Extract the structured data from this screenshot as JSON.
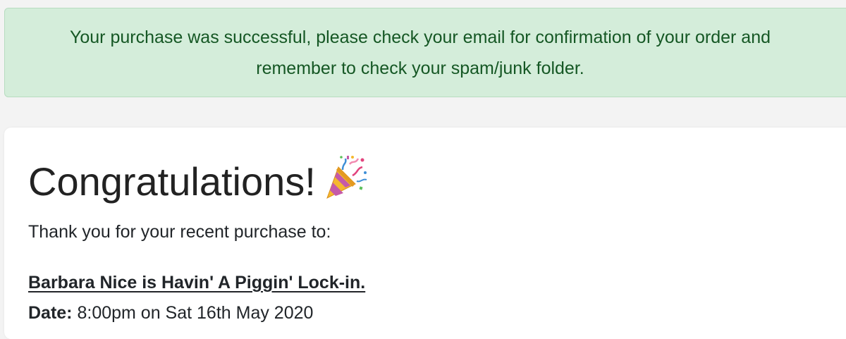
{
  "alert": {
    "line1": "Your purchase was successful, please check your email for confirmation of your order and",
    "line2": "remember to check your spam/junk folder.",
    "bg_color": "#d4edda",
    "text_color": "#155724"
  },
  "confirmation": {
    "title": "Congratulations!",
    "title_icon": "party-popper-icon",
    "subtitle": "Thank you for your recent purchase to:",
    "event_name": "Barbara Nice is Havin' A Piggin' Lock-in.",
    "date_label": "Date:",
    "date_value": "8:00pm on Sat 16th May 2020"
  }
}
